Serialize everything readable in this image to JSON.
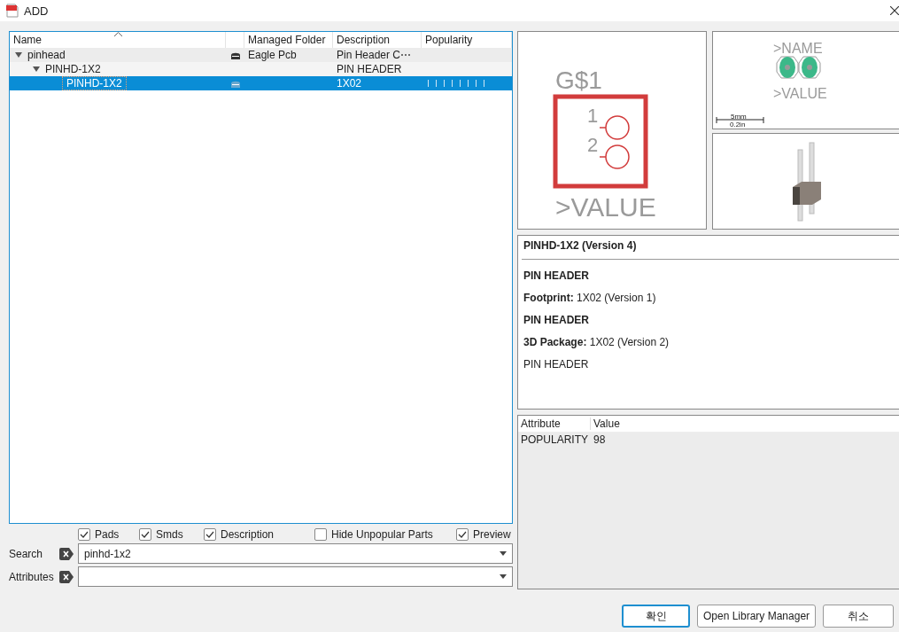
{
  "window": {
    "title": "ADD"
  },
  "tree": {
    "columns": [
      "Name",
      "Managed Folder",
      "Description",
      "Popularity"
    ],
    "rows": [
      {
        "name": "pinhead",
        "expanded": true,
        "selected": false,
        "folder": "Eagle Pcb",
        "description": "Pin Header C⋯",
        "has_icon": true,
        "children": [
          {
            "name": "PINHD-1X2",
            "expanded": true,
            "selected": false,
            "description": "PIN HEADER",
            "has_icon": false,
            "children": [
              {
                "name": "PINHD-1X2",
                "selected": true,
                "description": "1X02",
                "has_icon": true,
                "has_popularity": true
              }
            ]
          }
        ]
      }
    ]
  },
  "filters": [
    {
      "label": "Pads",
      "checked": true
    },
    {
      "label": "Smds",
      "checked": true
    },
    {
      "label": "Description",
      "checked": true
    },
    {
      "label": "Hide Unpopular Parts",
      "checked": false
    },
    {
      "label": "Preview",
      "checked": true
    }
  ],
  "search": {
    "label": "Search",
    "value": "pinhd-1x2"
  },
  "attributes_filter": {
    "label": "Attributes"
  },
  "symbol": {
    "name": "G$1",
    "pins": [
      "1",
      "2"
    ],
    "value": ">VALUE"
  },
  "package": {
    "name": ">NAME",
    "value": ">VALUE",
    "scale_top": "5mm",
    "scale_bottom": "0.2in"
  },
  "details": {
    "title": "PINHD-1X2 (Version 4)",
    "lines": [
      {
        "kind": "heading",
        "text": "PIN HEADER"
      },
      {
        "kind": "text",
        "text": "**Footprint:** 1X02 (Version 1)"
      },
      {
        "kind": "heading",
        "text": "PIN HEADER"
      },
      {
        "kind": "text",
        "text": "**3D Package:** 1X02 (Version 2)"
      },
      {
        "kind": "text",
        "text": "PIN HEADER"
      }
    ]
  },
  "attribute_table": {
    "columns": [
      "Attribute",
      "Value"
    ],
    "rows": [
      [
        "POPULARITY",
        "98"
      ]
    ]
  },
  "buttons": [
    {
      "label": "확인",
      "default": true
    },
    {
      "label": "Open Library Manager",
      "default": false
    },
    {
      "label": "취소",
      "default": false
    }
  ]
}
